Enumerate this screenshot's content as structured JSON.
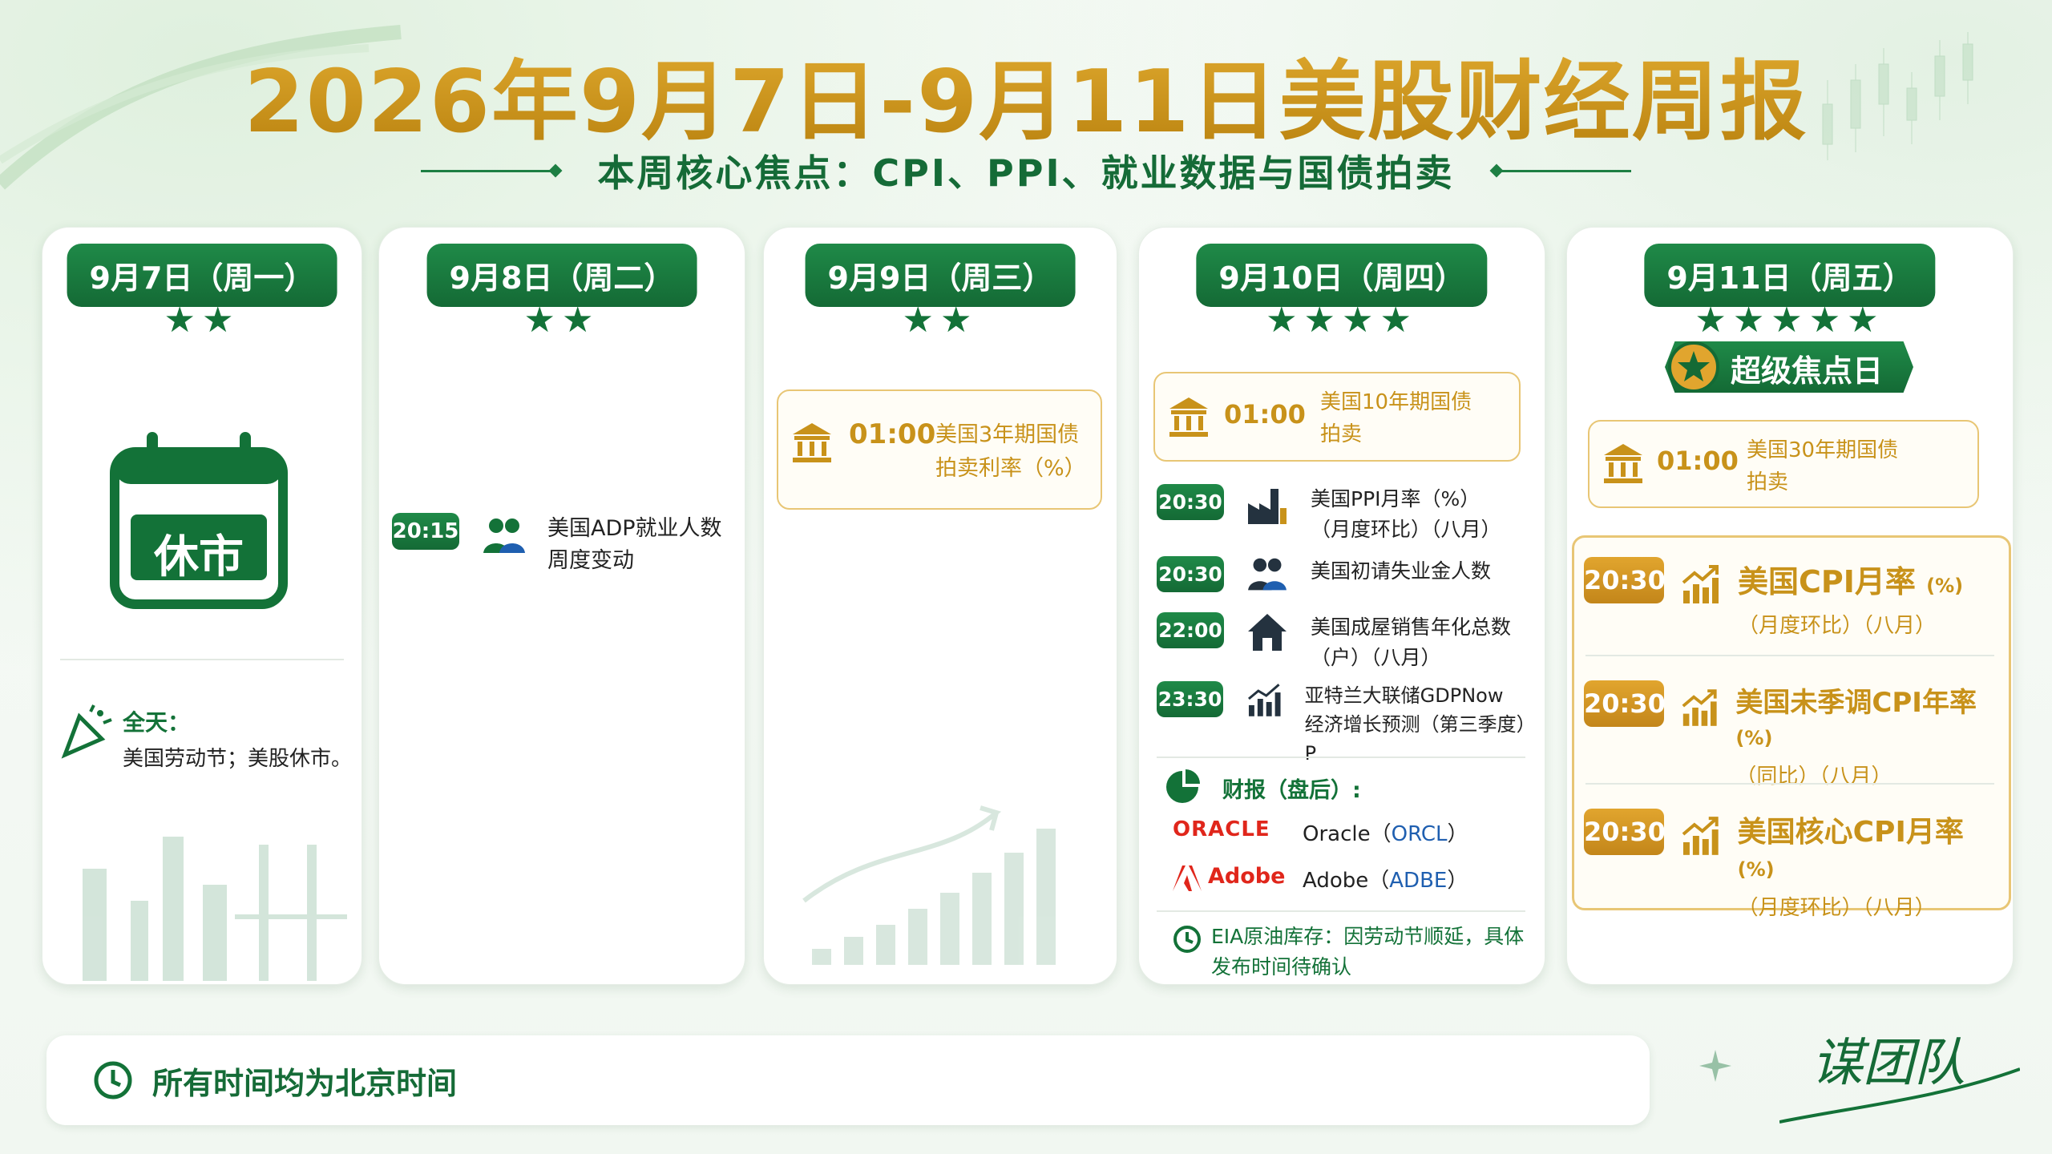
{
  "title": "2026年9月7日-9月11日美股财经周报",
  "subtitle": "本周核心焦点：CPI、PPI、就业数据与国债拍卖",
  "colors": {
    "green": "#146a35",
    "gold": "#c8921a"
  },
  "days": [
    {
      "date": "9月7日（周一）",
      "stars": "★★",
      "holiday_label": "休市",
      "allday_label": "全天：",
      "allday_text": "美国劳动节；美股休市。"
    },
    {
      "date": "9月8日（周二）",
      "stars": "★★",
      "events": [
        {
          "time": "20:15",
          "icon": "people-icon",
          "text1": "美国ADP就业人数",
          "text2": "周度变动"
        }
      ]
    },
    {
      "date": "9月9日（周三）",
      "stars": "★★",
      "events": [
        {
          "time": "01:00",
          "icon": "bank-icon",
          "text1": "美国3年期国债",
          "text2": "拍卖利率（%）"
        }
      ]
    },
    {
      "date": "9月10日（周四）",
      "stars": "★★★★",
      "auction": {
        "time": "01:00",
        "icon": "bank-icon",
        "text1": "美国10年期国债",
        "text2": "拍卖"
      },
      "events": [
        {
          "time": "20:30",
          "icon": "factory-icon",
          "text1": "美国PPI月率（%）",
          "text2": "（月度环比）（八月）"
        },
        {
          "time": "20:30",
          "icon": "people-icon",
          "text1": "美国初请失业金人数",
          "text2": ""
        },
        {
          "time": "22:00",
          "icon": "house-icon",
          "text1": "美国成屋销售年化总数",
          "text2": "（户）（八月）"
        },
        {
          "time": "23:30",
          "icon": "chart-icon",
          "text1": "亚特兰大联储GDPNow",
          "text2": "经济增长预测（第三季度）P"
        }
      ],
      "earnings_label": "财报（盘后）:",
      "earnings": [
        {
          "logo": "ORACLE",
          "name": "Oracle",
          "ticker": "ORCL"
        },
        {
          "logo": "Adobe",
          "name": "Adobe",
          "ticker": "ADBE"
        }
      ],
      "note": "EIA原油库存：因劳动节顺延，具体发布时间待确认"
    },
    {
      "date": "9月11日（周五）",
      "stars": "★★★★★",
      "super_label": "超级焦点日",
      "auction": {
        "time": "01:00",
        "icon": "bank-icon",
        "text1": "美国30年期国债",
        "text2": "拍卖"
      },
      "cpi": [
        {
          "time": "20:30",
          "title": "美国CPI月率",
          "unit": "(%)",
          "sub": "（月度环比）（八月）"
        },
        {
          "time": "20:30",
          "title": "美国未季调CPI年率",
          "unit": "(%)",
          "sub": "（同比）（八月）"
        },
        {
          "time": "20:30",
          "title": "美国核心CPI月率",
          "unit": "(%)",
          "sub": "（月度环比）（八月）"
        }
      ]
    }
  ],
  "footer": {
    "text": "所有时间均为北京时间",
    "icon": "clock-icon"
  },
  "brand": "谋团队"
}
